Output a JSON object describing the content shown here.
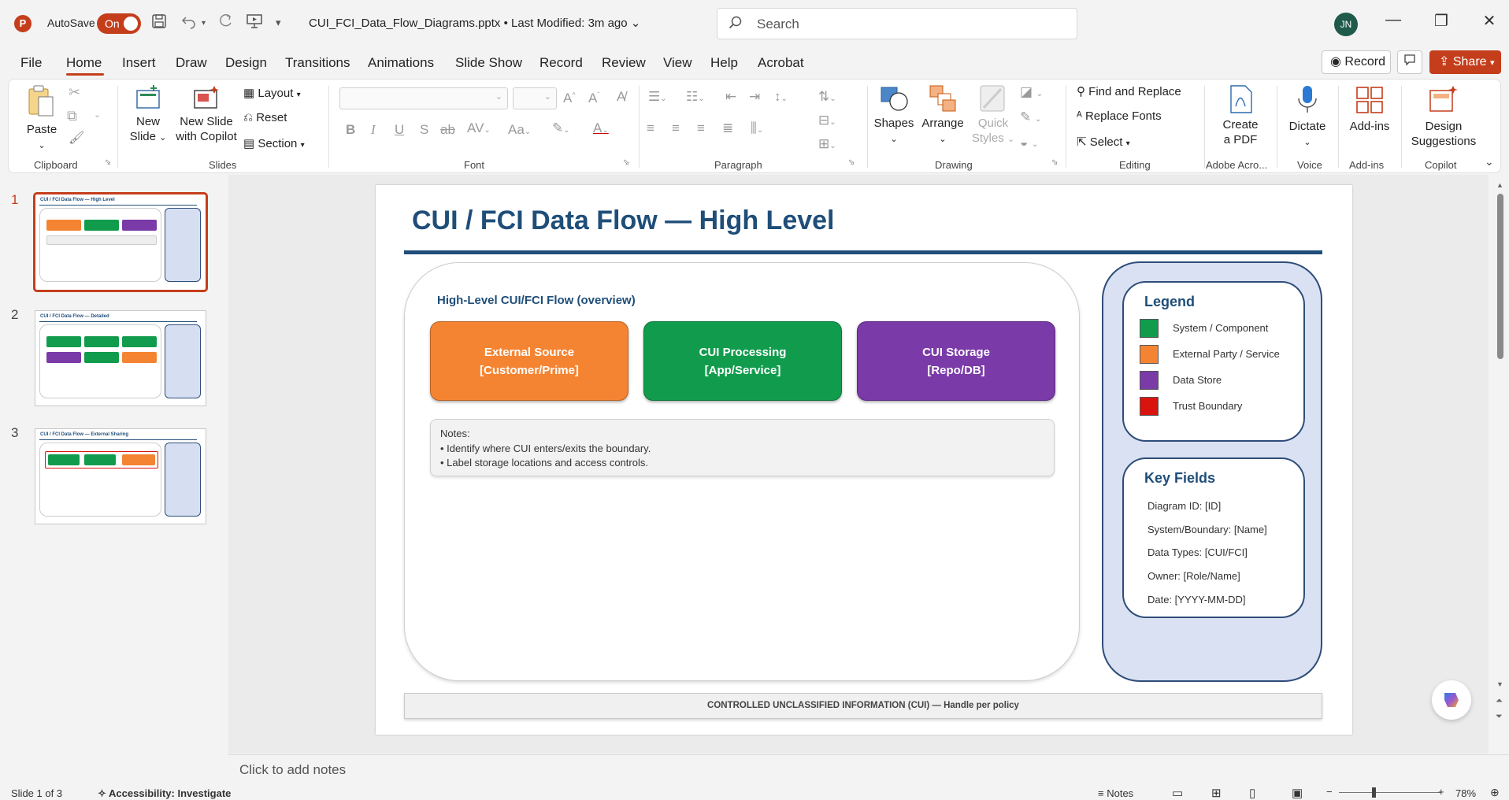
{
  "titlebar": {
    "app_icon": "P",
    "autosave_label": "AutoSave",
    "autosave_state": "On",
    "filename": "CUI_FCI_Data_Flow_Diagrams.pptx",
    "modified": "• Last Modified: 3m ago",
    "search_placeholder": "Search",
    "user_initials": "JN"
  },
  "menu": {
    "tabs": [
      "File",
      "Home",
      "Insert",
      "Draw",
      "Design",
      "Transitions",
      "Animations",
      "Slide Show",
      "Record",
      "Review",
      "View",
      "Help",
      "Acrobat"
    ],
    "active_tab": "Home",
    "record_label": "Record",
    "share_label": "Share"
  },
  "ribbon": {
    "clipboard": {
      "label": "Clipboard",
      "paste": "Paste"
    },
    "slides": {
      "label": "Slides",
      "new_slide_1": "New",
      "new_slide_2": "Slide",
      "new_copilot_1": "New Slide",
      "new_copilot_2": "with Copilot",
      "layout": "Layout",
      "reset": "Reset",
      "section": "Section"
    },
    "font": {
      "label": "Font"
    },
    "paragraph": {
      "label": "Paragraph"
    },
    "drawing": {
      "label": "Drawing",
      "shapes": "Shapes",
      "arrange": "Arrange",
      "quick_styles_1": "Quick",
      "quick_styles_2": "Styles"
    },
    "editing": {
      "label": "Editing",
      "find_replace": "Find and Replace",
      "replace_fonts": "Replace Fonts",
      "select": "Select"
    },
    "adobe": {
      "label": "Adobe Acro...",
      "create_pdf_1": "Create",
      "create_pdf_2": "a PDF"
    },
    "voice": {
      "label": "Voice",
      "dictate": "Dictate"
    },
    "addins": {
      "label": "Add-ins",
      "addins_btn": "Add-ins"
    },
    "copilot": {
      "label": "Copilot",
      "design_1": "Design",
      "design_2": "Suggestions"
    }
  },
  "thumbnails": [
    {
      "num": "1",
      "title": "CUI / FCI Data Flow — High Level"
    },
    {
      "num": "2",
      "title": "CUI / FCI Data Flow — Detailed"
    },
    {
      "num": "3",
      "title": "CUI / FCI Data Flow — External Sharing"
    }
  ],
  "slide": {
    "title": "CUI / FCI Data Flow — High Level",
    "subtitle": "High-Level CUI/FCI Flow (overview)",
    "boxes": [
      {
        "line1": "External Source",
        "line2": "[Customer/Prime]",
        "color": "#f58432"
      },
      {
        "line1": "CUI Processing",
        "line2": "[App/Service]",
        "color": "#119c4d"
      },
      {
        "line1": "CUI Storage",
        "line2": "[Repo/DB]",
        "color": "#7a3aa8"
      }
    ],
    "notes_heading": "Notes:",
    "notes": [
      "• Identify where CUI enters/exits the boundary.",
      "• Label storage locations and access controls."
    ],
    "legend_title": "Legend",
    "legend": [
      {
        "label": "System / Component",
        "color": "#119c4d"
      },
      {
        "label": "External Party / Service",
        "color": "#f58432"
      },
      {
        "label": "Data Store",
        "color": "#7a3aa8"
      },
      {
        "label": "Trust Boundary",
        "color": "#d9140e"
      }
    ],
    "key_fields_title": "Key Fields",
    "key_fields": [
      "Diagram ID: [ID]",
      "System/Boundary: [Name]",
      "Data Types: [CUI/FCI]",
      "Owner: [Role/Name]",
      "Date: [YYYY-MM-DD]"
    ],
    "footer": "CONTROLLED UNCLASSIFIED INFORMATION (CUI) — Handle per policy"
  },
  "notes_placeholder": "Click to add notes",
  "status": {
    "slide_count": "Slide 1 of 3",
    "accessibility": "Accessibility: Investigate",
    "notes_btn": "Notes",
    "zoom": "78%"
  }
}
